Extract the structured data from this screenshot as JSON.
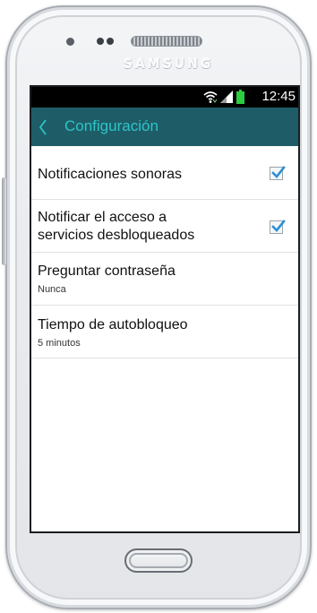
{
  "device": {
    "brand": "SAMSUNG"
  },
  "statusbar": {
    "time": "12:45",
    "icons": [
      "wifi-icon",
      "signal-icon",
      "battery-icon"
    ],
    "battery_color": "#2ecc40"
  },
  "actionbar": {
    "title": "Configuración",
    "back_icon": "chevron-left-icon",
    "color": "#1e5d67",
    "title_color": "#2ec4c9"
  },
  "settings": {
    "items": [
      {
        "title": "Notificaciones sonoras",
        "checked": true
      },
      {
        "title_line1": "Notificar el acceso a",
        "title_line2": "servicios desbloqueados",
        "checked": true
      },
      {
        "title": "Preguntar contraseña",
        "subtitle": "Nunca"
      },
      {
        "title": "Tiempo de autobloqueo",
        "subtitle": "5 minutos"
      }
    ]
  },
  "colors": {
    "checkmark": "#2c8fd6"
  }
}
